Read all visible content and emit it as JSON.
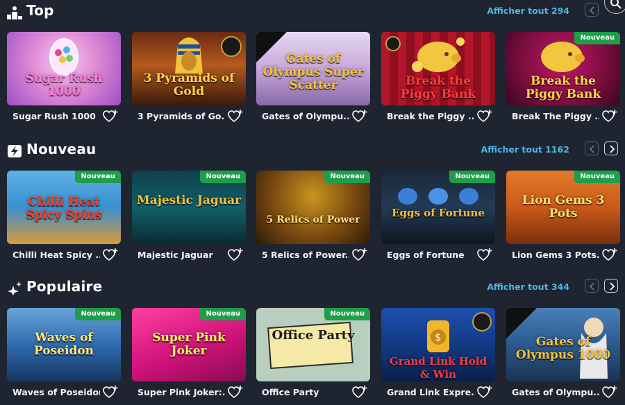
{
  "sections": [
    {
      "title": "Top",
      "icon": "podium-icon",
      "show_all": "Afficher tout 294",
      "games": [
        {
          "name": "Sugar Rush 1000",
          "logo": "Sugar Rush 1000",
          "badge_new": "",
          "drops": false,
          "jackpot": false
        },
        {
          "name": "3 Pyramids of Go...",
          "logo": "3 Pyramids of Gold",
          "badge_new": "",
          "drops": false,
          "jackpot": true
        },
        {
          "name": "Gates of Olympu...",
          "logo": "Gates of Olympus Super Scatter",
          "badge_new": "",
          "drops": true,
          "jackpot": false
        },
        {
          "name": "Break the Piggy ...",
          "logo": "Break the Piggy Bank",
          "badge_new": "",
          "drops": false,
          "jackpot": true
        },
        {
          "name": "Break The Piggy ...",
          "logo": "Break the Piggy Bank",
          "badge_new": "Nouveau",
          "drops": false,
          "jackpot": false
        }
      ]
    },
    {
      "title": "Nouveau",
      "icon": "lightning-badge-icon",
      "show_all": "Afficher tout 1162",
      "games": [
        {
          "name": "Chilli Heat Spicy ...",
          "logo": "Chilli Heat Spicy Spins",
          "badge_new": "Nouveau",
          "drops": false,
          "jackpot": false
        },
        {
          "name": "Majestic Jaguar",
          "logo": "Majestic Jaguar",
          "badge_new": "Nouveau",
          "drops": false,
          "jackpot": false
        },
        {
          "name": "5 Relics of Power...",
          "logo": "5 Relics of Power",
          "badge_new": "Nouveau",
          "drops": false,
          "jackpot": false
        },
        {
          "name": "Eggs of Fortune",
          "logo": "Eggs of Fortune",
          "badge_new": "Nouveau",
          "drops": false,
          "jackpot": false
        },
        {
          "name": "Lion Gems 3 Pots...",
          "logo": "Lion Gems 3 Pots",
          "badge_new": "Nouveau",
          "drops": false,
          "jackpot": false
        }
      ]
    },
    {
      "title": "Populaire",
      "icon": "star-sparkle-icon",
      "show_all": "Afficher tout 344",
      "games": [
        {
          "name": "Waves of Poseidon",
          "logo": "Waves of Poseidon",
          "badge_new": "Nouveau",
          "drops": false,
          "jackpot": false
        },
        {
          "name": "Super Pink Joker:...",
          "logo": "Super Pink Joker",
          "badge_new": "Nouveau",
          "drops": false,
          "jackpot": false
        },
        {
          "name": "Office Party",
          "logo": "Office Party",
          "badge_new": "Nouveau",
          "drops": false,
          "jackpot": false
        },
        {
          "name": "Grand Link Expre...",
          "logo": "Grand Link Hold & Win",
          "badge_new": "",
          "drops": false,
          "jackpot": true
        },
        {
          "name": "Gates of Olympu...",
          "logo": "Gates of Olympus 1000",
          "badge_new": "",
          "drops": true,
          "jackpot": false
        }
      ]
    }
  ],
  "colors": {
    "background": "#1f2530",
    "link": "#49b7e8",
    "badge_new": "#1e9e48"
  }
}
